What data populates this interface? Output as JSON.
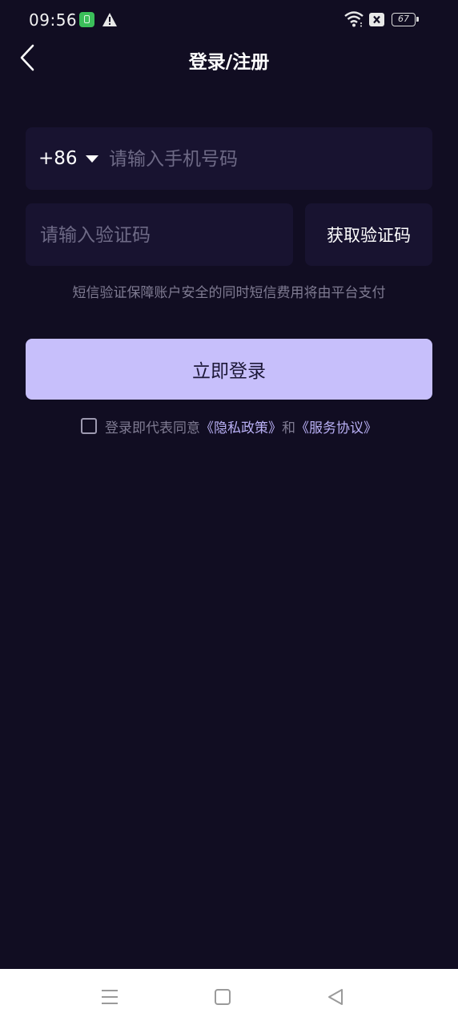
{
  "status_bar": {
    "time": "09:56",
    "battery_level": "67",
    "icons": [
      "green-app-icon",
      "warning-icon",
      "wifi-icon",
      "sim-x-icon",
      "battery-icon"
    ]
  },
  "header": {
    "title": "登录/注册",
    "back_icon": "chevron-left-icon"
  },
  "phone": {
    "country_code": "+86",
    "placeholder": "请输入手机号码",
    "value": ""
  },
  "verification": {
    "placeholder": "请输入验证码",
    "value": "",
    "get_code_label": "获取验证码"
  },
  "sms_note": "短信验证保障账户安全的同时短信费用将由平台支付",
  "login_button": "立即登录",
  "agreement": {
    "checked": false,
    "prefix": "登录即代表同意",
    "privacy_link": "《隐私政策》",
    "conjunction": "和",
    "service_link": "《服务协议》"
  },
  "nav_bar": {
    "icons": [
      "menu-icon",
      "home-square-icon",
      "back-triangle-icon"
    ]
  },
  "colors": {
    "background": "#110d22",
    "field_background": "#181330",
    "primary_button": "#c7bffb",
    "link": "#b9b0f5",
    "muted_text": "#7f7b92"
  }
}
